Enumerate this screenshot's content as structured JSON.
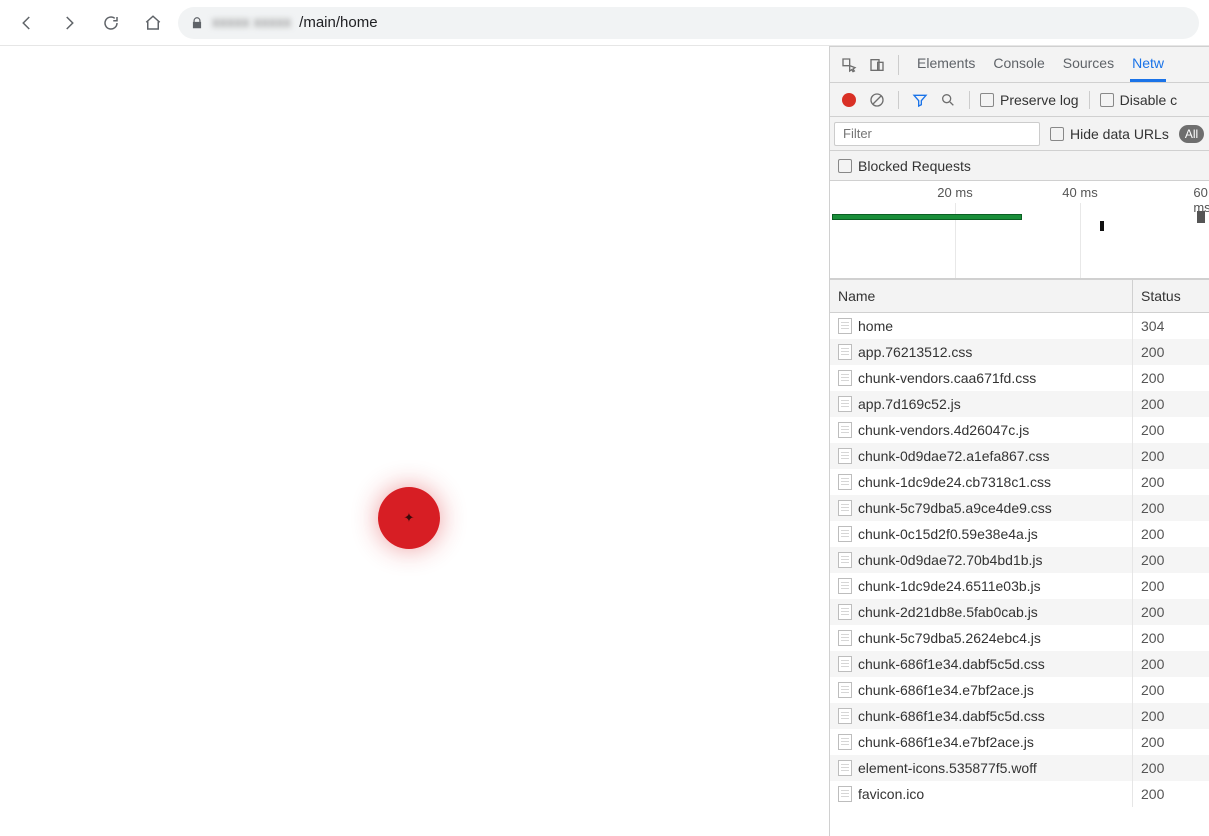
{
  "browser": {
    "url_blurred": "xxxxx xxxxx",
    "url_visible": "/main/home"
  },
  "devtools": {
    "tabs": {
      "elements": "Elements",
      "console": "Console",
      "sources": "Sources",
      "network": "Netw"
    },
    "toolbar": {
      "preserve_log": "Preserve log",
      "disable_cache": "Disable c"
    },
    "filter": {
      "placeholder": "Filter",
      "hide_data_urls": "Hide data URLs",
      "all_pill": "All"
    },
    "blocked_requests": "Blocked Requests",
    "timeline": {
      "t1": "20 ms",
      "t2": "40 ms",
      "t3": "60 ms"
    },
    "columns": {
      "name": "Name",
      "status": "Status"
    },
    "requests": [
      {
        "name": "home",
        "status": "304"
      },
      {
        "name": "app.76213512.css",
        "status": "200"
      },
      {
        "name": "chunk-vendors.caa671fd.css",
        "status": "200"
      },
      {
        "name": "app.7d169c52.js",
        "status": "200"
      },
      {
        "name": "chunk-vendors.4d26047c.js",
        "status": "200"
      },
      {
        "name": "chunk-0d9dae72.a1efa867.css",
        "status": "200"
      },
      {
        "name": "chunk-1dc9de24.cb7318c1.css",
        "status": "200"
      },
      {
        "name": "chunk-5c79dba5.a9ce4de9.css",
        "status": "200"
      },
      {
        "name": "chunk-0c15d2f0.59e38e4a.js",
        "status": "200"
      },
      {
        "name": "chunk-0d9dae72.70b4bd1b.js",
        "status": "200"
      },
      {
        "name": "chunk-1dc9de24.6511e03b.js",
        "status": "200"
      },
      {
        "name": "chunk-2d21db8e.5fab0cab.js",
        "status": "200"
      },
      {
        "name": "chunk-5c79dba5.2624ebc4.js",
        "status": "200"
      },
      {
        "name": "chunk-686f1e34.dabf5c5d.css",
        "status": "200"
      },
      {
        "name": "chunk-686f1e34.e7bf2ace.js",
        "status": "200"
      },
      {
        "name": "chunk-686f1e34.dabf5c5d.css",
        "status": "200"
      },
      {
        "name": "chunk-686f1e34.e7bf2ace.js",
        "status": "200"
      },
      {
        "name": "element-icons.535877f5.woff",
        "status": "200"
      },
      {
        "name": "favicon.ico",
        "status": "200"
      }
    ]
  }
}
